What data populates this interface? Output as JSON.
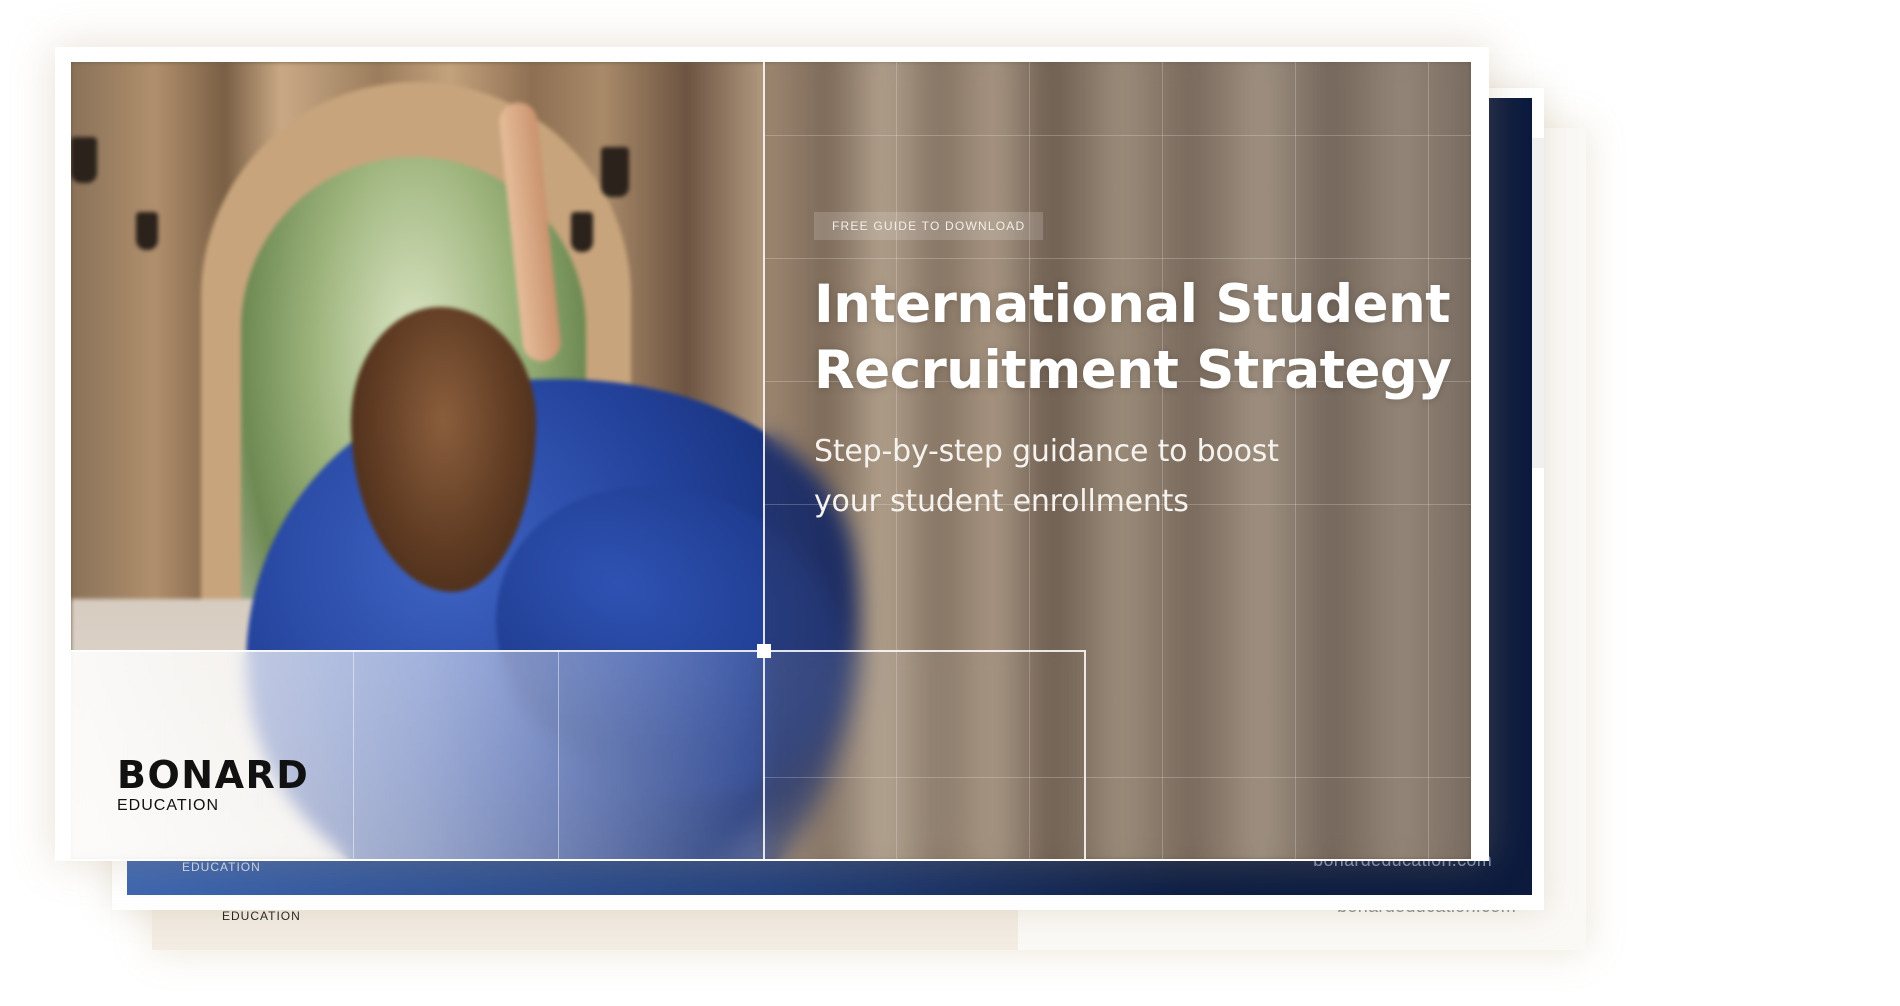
{
  "cover": {
    "badge": "FREE GUIDE TO DOWNLOAD",
    "title_line1": "International Student",
    "title_line2": "Recruitment Strategy",
    "subtitle_line1": "Step-by-step guidance to boost",
    "subtitle_line2": "your student enrollments"
  },
  "brand": {
    "name": "BONARD",
    "tagline": "EDUCATION",
    "website": "bonardeducation.com"
  },
  "colors": {
    "navy": "#0b1a3d",
    "royal_blue": "#3d66b0",
    "gown_blue": "#23429b",
    "text_light": "#ffffff",
    "logo_dark": "#111111"
  }
}
